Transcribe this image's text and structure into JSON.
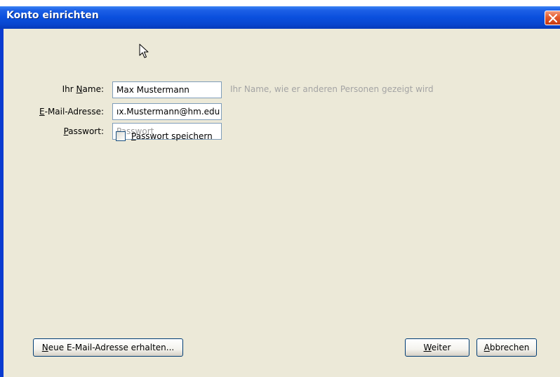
{
  "window": {
    "title": "Konto einrichten"
  },
  "form": {
    "name": {
      "label_pre": "Ihr ",
      "label_key": "N",
      "label_post": "ame:",
      "value": "Max Mustermann",
      "hint": "Ihr Name, wie er anderen Personen gezeigt wird"
    },
    "email": {
      "label_key": "E",
      "label_post": "-Mail-Adresse:",
      "value": "ıx.Mustermann@hm.edu"
    },
    "password": {
      "label_key": "P",
      "label_post": "asswort:",
      "placeholder": "Passwort"
    },
    "remember": {
      "label_key": "P",
      "label_post": "asswort speichern",
      "checked": false
    }
  },
  "buttons": {
    "new_address_key": "N",
    "new_address_post": "eue E-Mail-Adresse erhalten...",
    "next_key": "W",
    "next_post": "eiter",
    "cancel_key": "A",
    "cancel_post": "bbrechen"
  },
  "colors": {
    "titlebar": "#0a4fdd",
    "client_bg": "#ece9d8",
    "close_button": "#e25a2c",
    "hint_text": "#a4a4a4"
  },
  "icons": {
    "close": "close-icon",
    "cursor": "mouse-pointer-icon"
  }
}
